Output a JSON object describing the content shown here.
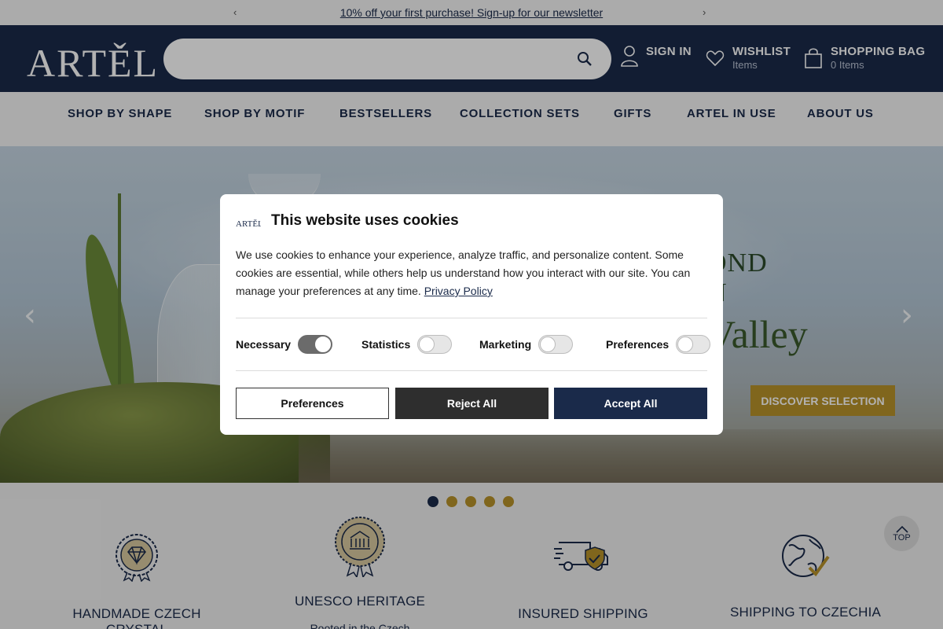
{
  "announcement": {
    "text": "10% off your first purchase! Sign-up for our newsletter",
    "prev": "‹",
    "next": "›"
  },
  "header": {
    "logo_text": "ARTĚL",
    "search": {
      "placeholder": "",
      "icon": "search-icon"
    },
    "sign_in": {
      "label": "SIGN IN",
      "icon": "user-icon"
    },
    "wishlist": {
      "label": "WISHLIST",
      "sub": "Items",
      "icon": "heart-icon"
    },
    "bag": {
      "label": "SHOPPING BAG",
      "sub": "0 Items",
      "icon": "bag-icon"
    }
  },
  "nav": {
    "items": [
      "SHOP BY SHAPE",
      "SHOP BY MOTIF",
      "BESTSELLERS",
      "COLLECTION SETS",
      "GIFTS",
      "ARTEL IN USE",
      "ABOUT US"
    ]
  },
  "hero": {
    "line1": "OND",
    "line2": "N",
    "line3": "Valley",
    "cta": "DISCOVER SELECTION",
    "prev_arrow": "‹",
    "next_arrow": "›",
    "slides_total": 5,
    "slide_active": 1
  },
  "features": [
    {
      "title": "HANDMADE CZECH CRYSTAL",
      "icon": "diamond-badge-icon",
      "desc": ""
    },
    {
      "title": "UNESCO HERITAGE",
      "icon": "unesco-medal-icon",
      "desc": "Rooted in the Czech"
    },
    {
      "title": "INSURED SHIPPING",
      "icon": "truck-shield-icon",
      "desc": ""
    },
    {
      "title": "SHIPPING TO CZECHIA",
      "icon": "globe-check-icon",
      "desc": ""
    }
  ],
  "top_button": {
    "label": "TOP"
  },
  "cookie": {
    "logo": "ARTĚL",
    "title": "This website uses cookies",
    "body": "We use cookies to enhance your experience, analyze traffic, and personalize content. Some cookies are essential, while others help us understand how you interact with our site. You can manage your preferences at any time.",
    "privacy_link": "Privacy Policy",
    "toggles": [
      {
        "label": "Necessary",
        "on": true
      },
      {
        "label": "Statistics",
        "on": false
      },
      {
        "label": "Marketing",
        "on": false
      },
      {
        "label": "Preferences",
        "on": false
      }
    ],
    "buttons": {
      "preferences": "Preferences",
      "reject": "Reject All",
      "accept": "Accept All"
    }
  },
  "colors": {
    "navy": "#1a2a4a",
    "gold": "#b8922a",
    "overlay": "rgba(0,0,0,0.3)"
  }
}
